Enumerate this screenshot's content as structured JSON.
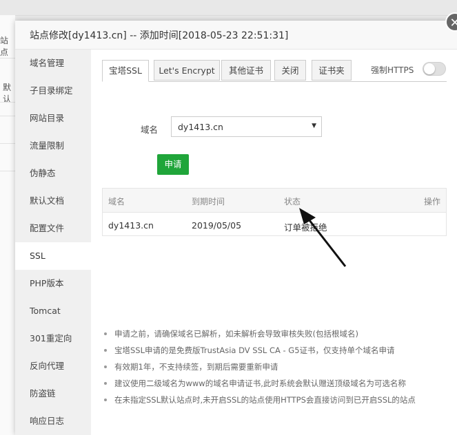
{
  "background": {
    "frag_top": "站点",
    "frag_mid": "默认"
  },
  "dialog": {
    "title": "站点修改[dy1413.cn] -- 添加时间[2018-05-23 22:51:31]",
    "close_glyph": "✕"
  },
  "sidebar": {
    "items": [
      {
        "label": "域名管理"
      },
      {
        "label": "子目录绑定"
      },
      {
        "label": "网站目录"
      },
      {
        "label": "流量限制"
      },
      {
        "label": "伪静态"
      },
      {
        "label": "默认文档"
      },
      {
        "label": "配置文件"
      },
      {
        "label": "SSL"
      },
      {
        "label": "PHP版本"
      },
      {
        "label": "Tomcat"
      },
      {
        "label": "301重定向"
      },
      {
        "label": "反向代理"
      },
      {
        "label": "防盗链"
      },
      {
        "label": "响应日志"
      }
    ],
    "active": "SSL"
  },
  "tabs": [
    {
      "label": "宝塔SSL"
    },
    {
      "label": "Let's Encrypt"
    },
    {
      "label": "其他证书"
    },
    {
      "label": "关闭"
    },
    {
      "label": "证书夹"
    }
  ],
  "force_https": {
    "label": "强制HTTPS",
    "on": false
  },
  "form": {
    "domain_label": "域名",
    "domain_value": "dy1413.cn",
    "apply_label": "申请"
  },
  "table": {
    "headers": [
      "域名",
      "到期时间",
      "状态",
      "操作"
    ],
    "rows": [
      [
        "dy1413.cn",
        "2019/05/05",
        "订单被拒绝",
        ""
      ]
    ]
  },
  "tips": [
    "申请之前，请确保域名已解析，如未解析会导致审核失败(包括根域名)",
    "宝塔SSL申请的是免费版TrustAsia DV SSL CA - G5证书，仅支持单个域名申请",
    "有效期1年，不支持续签，到期后需要重新申请",
    "建议使用二级域名为www的域名申请证书,此时系统会默认赠送顶级域名为可选名称",
    "在未指定SSL默认站点时,未开启SSL的站点使用HTTPS会直接访问到已开启SSL的站点"
  ],
  "colors": {
    "accent_green": "#20a53a",
    "sidebar_bg": "#f0f0f0"
  }
}
